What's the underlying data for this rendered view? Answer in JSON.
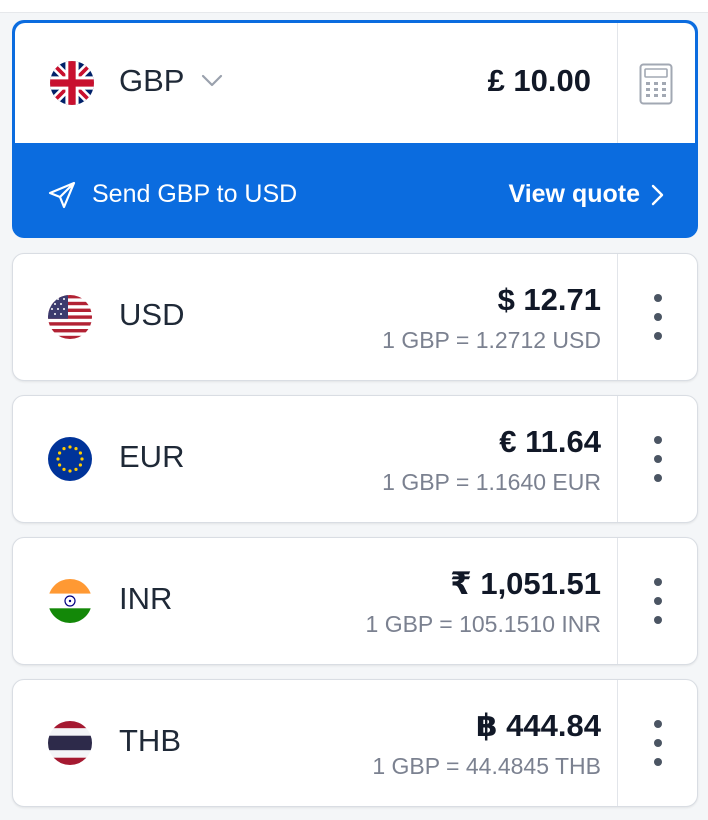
{
  "base": {
    "code": "GBP",
    "amount": "£ 10.00",
    "send_label": "Send GBP to USD",
    "quote_label": "View quote"
  },
  "rates": [
    {
      "code": "USD",
      "amount": "$ 12.71",
      "rate": "1 GBP = 1.2712 USD",
      "flag": "us-flag-icon"
    },
    {
      "code": "EUR",
      "amount": "€ 11.64",
      "rate": "1 GBP = 1.1640 EUR",
      "flag": "eu-flag-icon"
    },
    {
      "code": "INR",
      "amount": "₹ 1,051.51",
      "rate": "1 GBP = 105.1510 INR",
      "flag": "india-flag-icon"
    },
    {
      "code": "THB",
      "amount": "฿ 444.84",
      "rate": "1 GBP = 44.4845 THB",
      "flag": "thailand-flag-icon"
    }
  ],
  "colors": {
    "accent": "#0b6cdf",
    "text": "#111827",
    "muted": "#7b8190",
    "border": "#d9dde3"
  }
}
